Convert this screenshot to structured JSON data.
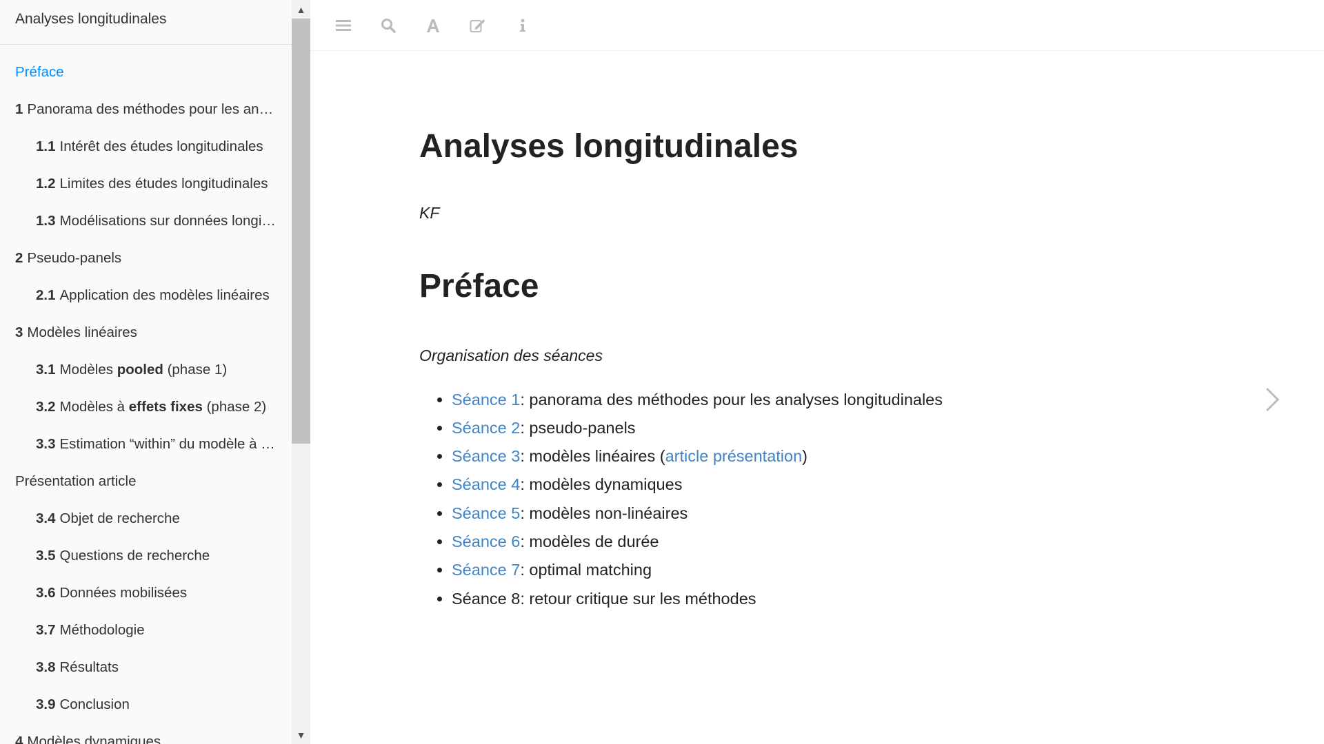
{
  "sidebar": {
    "book_title": "Analyses longitudinales",
    "toc": [
      {
        "num": "",
        "text": "Préface",
        "level": 1,
        "active": true
      },
      {
        "num": "1",
        "text": "Panorama des méthodes pour les analyses longitudinales",
        "level": 1
      },
      {
        "num": "1.1",
        "text": "Intérêt des études longitudinales",
        "level": 2
      },
      {
        "num": "1.2",
        "text": "Limites des études longitudinales",
        "level": 2
      },
      {
        "num": "1.3",
        "text": "Modélisations sur données longitudinales",
        "level": 2
      },
      {
        "num": "2",
        "text": "Pseudo-panels",
        "level": 1
      },
      {
        "num": "2.1",
        "text": "Application des modèles linéaires",
        "level": 2
      },
      {
        "num": "3",
        "text": "Modèles linéaires",
        "level": 1
      },
      {
        "num": "3.1",
        "text_before": "Modèles ",
        "bold": "pooled",
        "text_after": " (phase 1)",
        "level": 2
      },
      {
        "num": "3.2",
        "text_before": "Modèles à ",
        "bold": "effets fixes",
        "text_after": " (phase 2)",
        "level": 2
      },
      {
        "num": "3.3",
        "text": "Estimation “within” du modèle à effets fixes",
        "level": 2
      },
      {
        "num": "",
        "text": "Présentation article",
        "level": 1
      },
      {
        "num": "3.4",
        "text": "Objet de recherche",
        "level": 2
      },
      {
        "num": "3.5",
        "text": "Questions de recherche",
        "level": 2
      },
      {
        "num": "3.6",
        "text": "Données mobilisées",
        "level": 2
      },
      {
        "num": "3.7",
        "text": "Méthodologie",
        "level": 2
      },
      {
        "num": "3.8",
        "text": "Résultats",
        "level": 2
      },
      {
        "num": "3.9",
        "text": "Conclusion",
        "level": 2
      },
      {
        "num": "4",
        "text": "Modèles dynamiques",
        "level": 1
      }
    ]
  },
  "toolbar": {
    "icons": [
      "menu-icon",
      "search-icon",
      "font-icon",
      "edit-icon",
      "info-icon"
    ],
    "icon_color": "#bbbbbb"
  },
  "content": {
    "title": "Analyses longitudinales",
    "author": "KF",
    "preface_heading": "Préface",
    "org_label": "Organisation des séances",
    "sessions": [
      {
        "link": "Séance 1",
        "rest": ": panorama des méthodes pour les analyses longitudinales"
      },
      {
        "link": "Séance 2",
        "rest": ": pseudo-panels"
      },
      {
        "link": "Séance 3",
        "rest": ": modèles linéaires (",
        "link2": "article présentation",
        "rest2": ")"
      },
      {
        "link": "Séance 4",
        "rest": ": modèles dynamiques"
      },
      {
        "link": "Séance 5",
        "rest": ": modèles non-linéaires"
      },
      {
        "link": "Séance 6",
        "rest": ": modèles de durée"
      },
      {
        "link": "Séance 7",
        "rest": ": optimal matching"
      },
      {
        "plain": "Séance 8",
        "rest": ": retour critique sur les méthodes"
      }
    ]
  },
  "colors": {
    "link": "#4183c4",
    "active_toc": "#008cff"
  }
}
